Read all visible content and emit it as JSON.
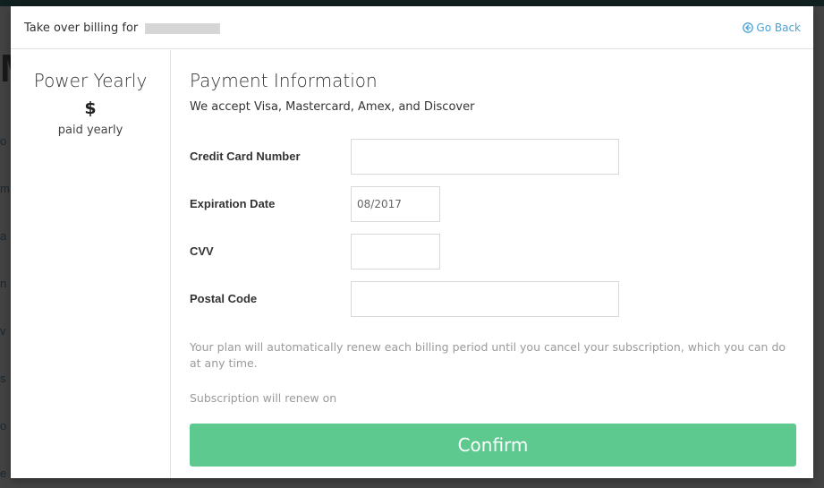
{
  "header": {
    "title_prefix": "Take over billing for",
    "go_back_label": "Go Back"
  },
  "plan": {
    "name": "Power Yearly",
    "price": "$",
    "period": "paid yearly"
  },
  "payment": {
    "title": "Payment Information",
    "subtitle": "We accept Visa, Mastercard, Amex, and Discover",
    "fields": {
      "card_number": {
        "label": "Credit Card Number",
        "value": "",
        "placeholder": ""
      },
      "expiration": {
        "label": "Expiration Date",
        "value": "",
        "placeholder": "08/2017"
      },
      "cvv": {
        "label": "CVV",
        "value": "",
        "placeholder": ""
      },
      "postal_code": {
        "label": "Postal Code",
        "value": "",
        "placeholder": ""
      }
    },
    "renew_note": "Your plan will automatically renew each billing period until you cancel your subscription, which you can do at any time.",
    "renew_date_text": "Subscription will renew on",
    "confirm_label": "Confirm"
  },
  "colors": {
    "accent_green": "#5dc98f",
    "link_blue": "#4aa3d8"
  },
  "icons": {
    "go_back": "circle-arrow-left-icon"
  }
}
